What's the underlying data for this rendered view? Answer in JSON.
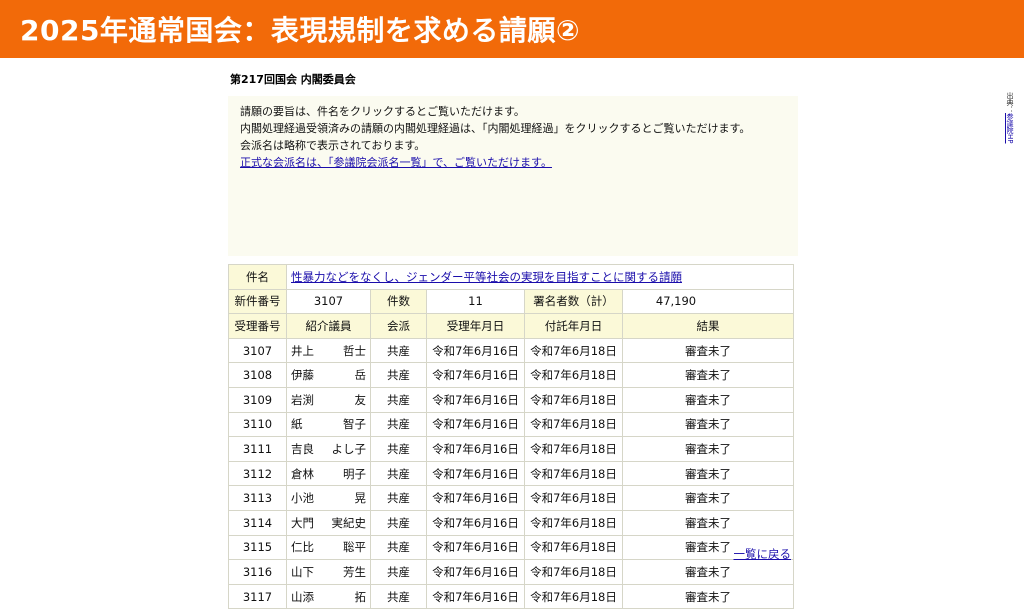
{
  "banner": {
    "title": "2025年通常国会：表現規制を求める請願②"
  },
  "committee": {
    "title": "第217回国会 内閣委員会"
  },
  "intro": {
    "line1": "請願の要旨は、件名をクリックするとご覧いただけます。",
    "line2": "内閣処理経過受領済みの請願の内閣処理経過は、「内閣処理経過」をクリックするとご覧いただけます。",
    "line3": "会派名は略称で表示されております。",
    "link": "正式な会派名は、「参議院会派名一覧」で、ご覧いただけます。"
  },
  "table": {
    "subject_label": "件名",
    "subject": "性暴力などをなくし、ジェンダー平等社会の実現を目指すことに関する請願",
    "new_number_label": "新件番号",
    "new_number": "3107",
    "count_label": "件数",
    "count": "11",
    "signers_label": "署名者数（計）",
    "signers": "47,190",
    "headers": [
      "受理番号",
      "紹介議員",
      "会派",
      "受理年月日",
      "付託年月日",
      "結果"
    ],
    "rows": [
      {
        "num": "3107",
        "last": "井上",
        "first": "哲士",
        "party": "共産",
        "received": "令和7年6月16日",
        "referred": "令和7年6月18日",
        "result": "審査未了"
      },
      {
        "num": "3108",
        "last": "伊藤",
        "first": "岳",
        "party": "共産",
        "received": "令和7年6月16日",
        "referred": "令和7年6月18日",
        "result": "審査未了"
      },
      {
        "num": "3109",
        "last": "岩渕",
        "first": "友",
        "party": "共産",
        "received": "令和7年6月16日",
        "referred": "令和7年6月18日",
        "result": "審査未了"
      },
      {
        "num": "3110",
        "last": "紙",
        "first": "智子",
        "party": "共産",
        "received": "令和7年6月16日",
        "referred": "令和7年6月18日",
        "result": "審査未了"
      },
      {
        "num": "3111",
        "last": "吉良",
        "first": "よし子",
        "party": "共産",
        "received": "令和7年6月16日",
        "referred": "令和7年6月18日",
        "result": "審査未了"
      },
      {
        "num": "3112",
        "last": "倉林",
        "first": "明子",
        "party": "共産",
        "received": "令和7年6月16日",
        "referred": "令和7年6月18日",
        "result": "審査未了"
      },
      {
        "num": "3113",
        "last": "小池",
        "first": "晃",
        "party": "共産",
        "received": "令和7年6月16日",
        "referred": "令和7年6月18日",
        "result": "審査未了"
      },
      {
        "num": "3114",
        "last": "大門",
        "first": "実紀史",
        "party": "共産",
        "received": "令和7年6月16日",
        "referred": "令和7年6月18日",
        "result": "審査未了"
      },
      {
        "num": "3115",
        "last": "仁比",
        "first": "聡平",
        "party": "共産",
        "received": "令和7年6月16日",
        "referred": "令和7年6月18日",
        "result": "審査未了"
      },
      {
        "num": "3116",
        "last": "山下",
        "first": "芳生",
        "party": "共産",
        "received": "令和7年6月16日",
        "referred": "令和7年6月18日",
        "result": "審査未了"
      },
      {
        "num": "3117",
        "last": "山添",
        "first": "拓",
        "party": "共産",
        "received": "令和7年6月16日",
        "referred": "令和7年6月18日",
        "result": "審査未了"
      }
    ]
  },
  "back_link": "一覧に戻る",
  "source": {
    "label": "出典：",
    "link": "参議院HP"
  },
  "colors": {
    "banner": "#f26a09",
    "link": "#1a0dab",
    "label_bg": "#fbf9d8",
    "intro_bg": "#fbfbf0"
  }
}
